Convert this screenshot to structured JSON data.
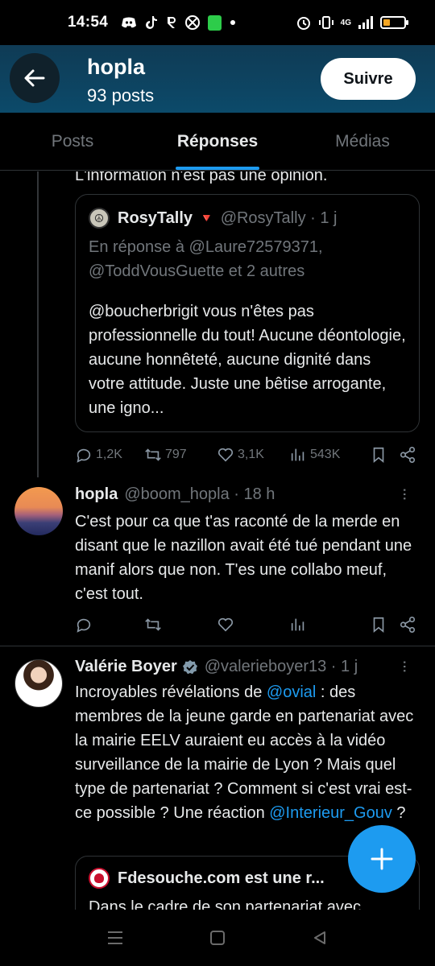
{
  "status_bar": {
    "time": "14:54",
    "left_icons": [
      "discord-icon",
      "tiktok-icon",
      "r-app-icon",
      "xbox-icon",
      "green-app-icon",
      "dot-icon"
    ],
    "network": "4G",
    "right_icons": [
      "alarm-icon",
      "vibrate-icon",
      "signal-icon",
      "battery-icon"
    ]
  },
  "header": {
    "title": "hopla",
    "subtitle": "93 posts",
    "follow_label": "Suivre"
  },
  "tabs": [
    {
      "label": "Posts",
      "active": false
    },
    {
      "label": "Réponses",
      "active": true
    },
    {
      "label": "Médias",
      "active": false
    }
  ],
  "feed": {
    "cut_text": "L'information n'est pas une opinion.",
    "quote": {
      "name": "RosyTally",
      "flag": "🔻",
      "handle": "@RosyTally · 1 j",
      "reply_line1": "En réponse à @Laure72579371,",
      "reply_line2": "@ToddVousGuette et 2 autres",
      "body": "@boucherbrigit vous n'êtes pas professionnelle du tout! Aucune déontologie, aucune honnêteté, aucune dignité dans votre attitude. Juste une bêtise arrogante, une igno..."
    },
    "actions_1": {
      "replies": "1,2K",
      "reposts": "797",
      "likes": "3,1K",
      "views": "543K"
    },
    "tweet_hopla": {
      "name": "hopla",
      "handle": "@boom_hopla · 18 h",
      "body": "C'est pour ca que t'as raconté de la merde en disant que le nazillon avait été tué pendant une manif alors que non. T'es une collabo meuf, c'est tout."
    },
    "tweet_valerie": {
      "name": "Valérie Boyer",
      "handle": "@valerieboyer13 · 1 j",
      "body_pre": "Incroyables révélations de ",
      "mention1": "@ovial",
      "body_mid": " : des membres de la jeune garde en partenariat avec la mairie EELV auraient eu accès à la vidéo surveillance de la mairie de Lyon ? Mais quel type de partenariat ? Comment si c'est vrai est-ce possible ? Une réaction  ",
      "mention2": "@Interieur_Gouv",
      "body_post": " ?"
    },
    "quote2": {
      "name": "Fdesouche.com est une r...",
      "body": "Dans le cadre de son partenariat avec"
    }
  },
  "colors": {
    "accent": "#1d9bf0",
    "header_bg": "#0c4a6a",
    "text": "#e7e9ea",
    "muted": "#71767b"
  }
}
